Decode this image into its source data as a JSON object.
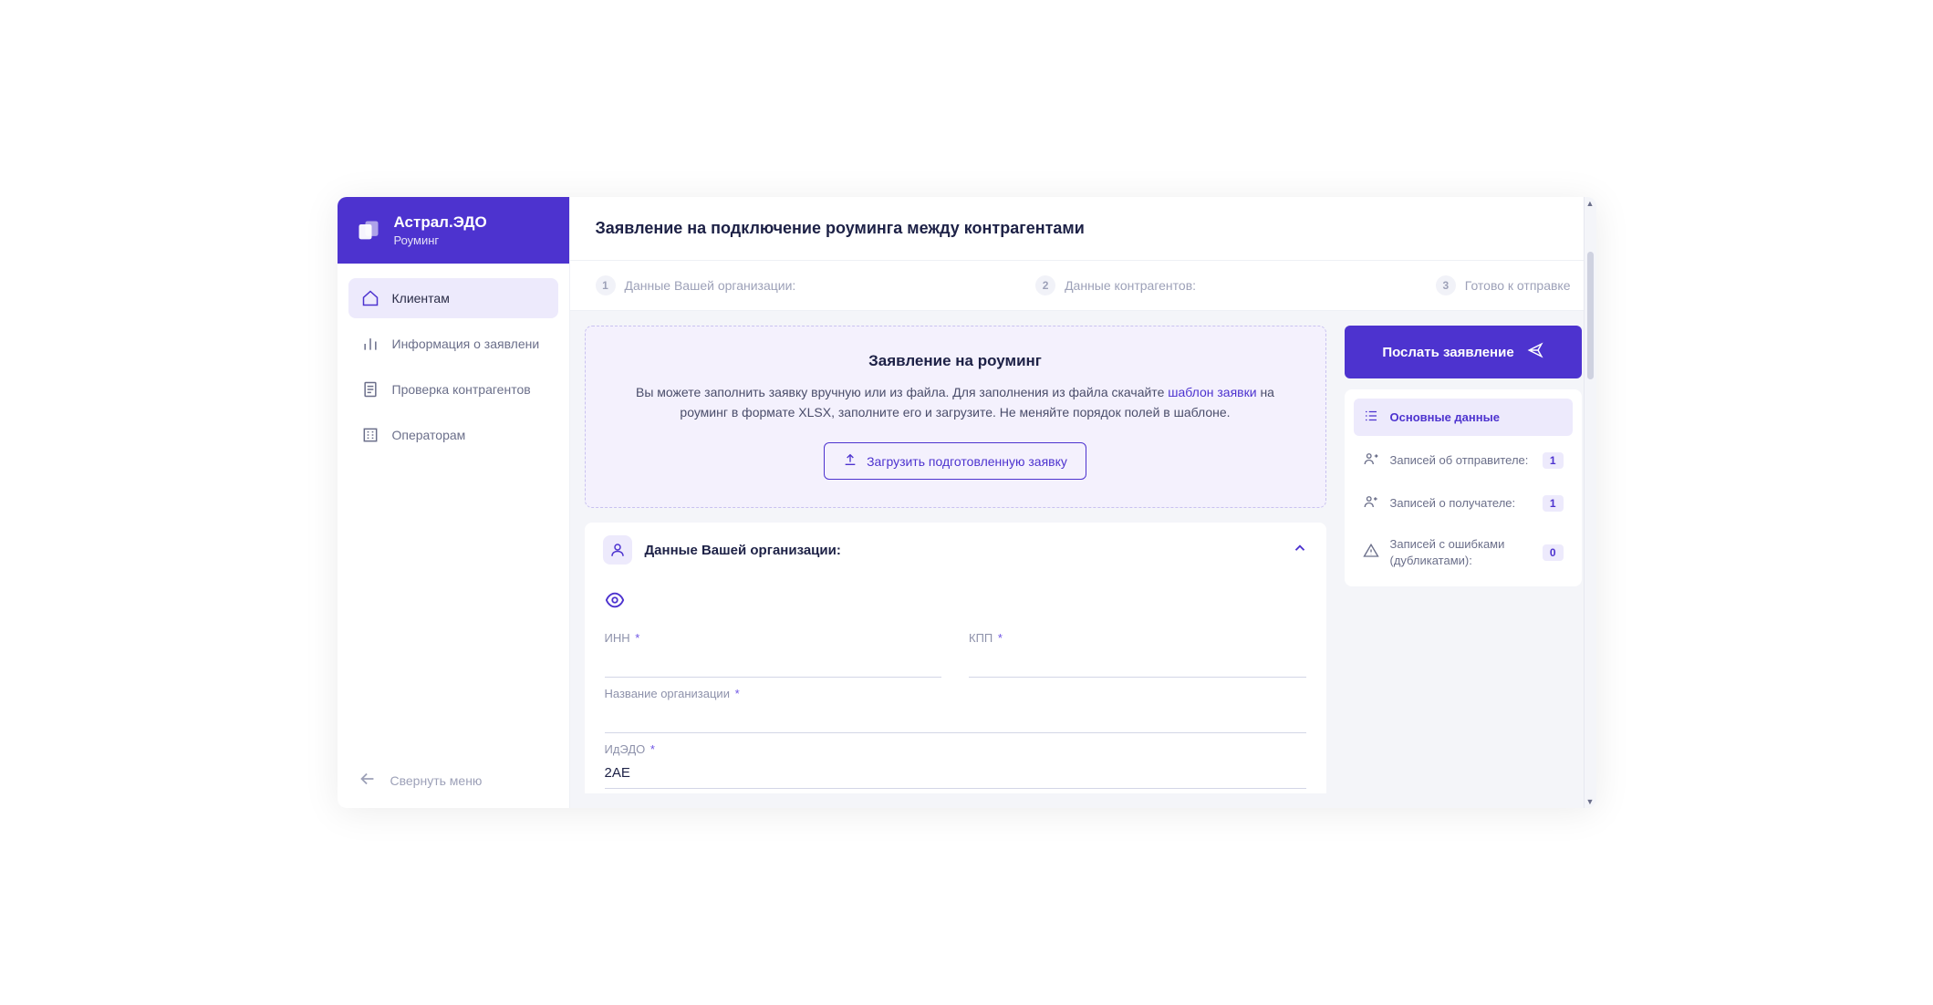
{
  "brand": {
    "title": "Астрал.ЭДО",
    "subtitle": "Роуминг"
  },
  "sidebar": {
    "items": [
      {
        "label": "Клиентам"
      },
      {
        "label": "Информация о заявлени"
      },
      {
        "label": "Проверка контрагентов"
      },
      {
        "label": "Операторам"
      }
    ],
    "collapse_label": "Свернуть меню"
  },
  "page": {
    "title": "Заявление на подключение роуминга между контрагентами"
  },
  "steps": {
    "s1": {
      "num": "1",
      "label": "Данные Вашей организации:"
    },
    "s2": {
      "num": "2",
      "label": "Данные контрагентов:"
    },
    "s3": {
      "num": "3",
      "label": "Готово к отправке"
    }
  },
  "upload": {
    "title": "Заявление на роуминг",
    "text_before": "Вы можете заполнить заявку вручную или из файла. Для заполнения из файла скачайте ",
    "link": "шаблон заявки",
    "text_after": " на роуминг в формате XLSX, заполните его и загрузите. Не меняйте порядок полей в шаблоне.",
    "button": "Загрузить подготовленную заявку"
  },
  "org": {
    "title": "Данные Вашей организации:",
    "fields": {
      "inn": {
        "label": "ИНН",
        "value": ""
      },
      "kpp": {
        "label": "КПП",
        "value": ""
      },
      "name": {
        "label": "Название организации",
        "value": ""
      },
      "idedo": {
        "label": "ИдЭДО",
        "value": "2AE"
      }
    }
  },
  "send_button": "Послать заявление",
  "summary": {
    "primary": "Основные данные",
    "rows": [
      {
        "label": "Записей об отправителе:",
        "count": "1"
      },
      {
        "label": "Записей о получателе:",
        "count": "1"
      },
      {
        "label": "Записей с ошибками (дубликатами):",
        "count": "0"
      }
    ]
  }
}
